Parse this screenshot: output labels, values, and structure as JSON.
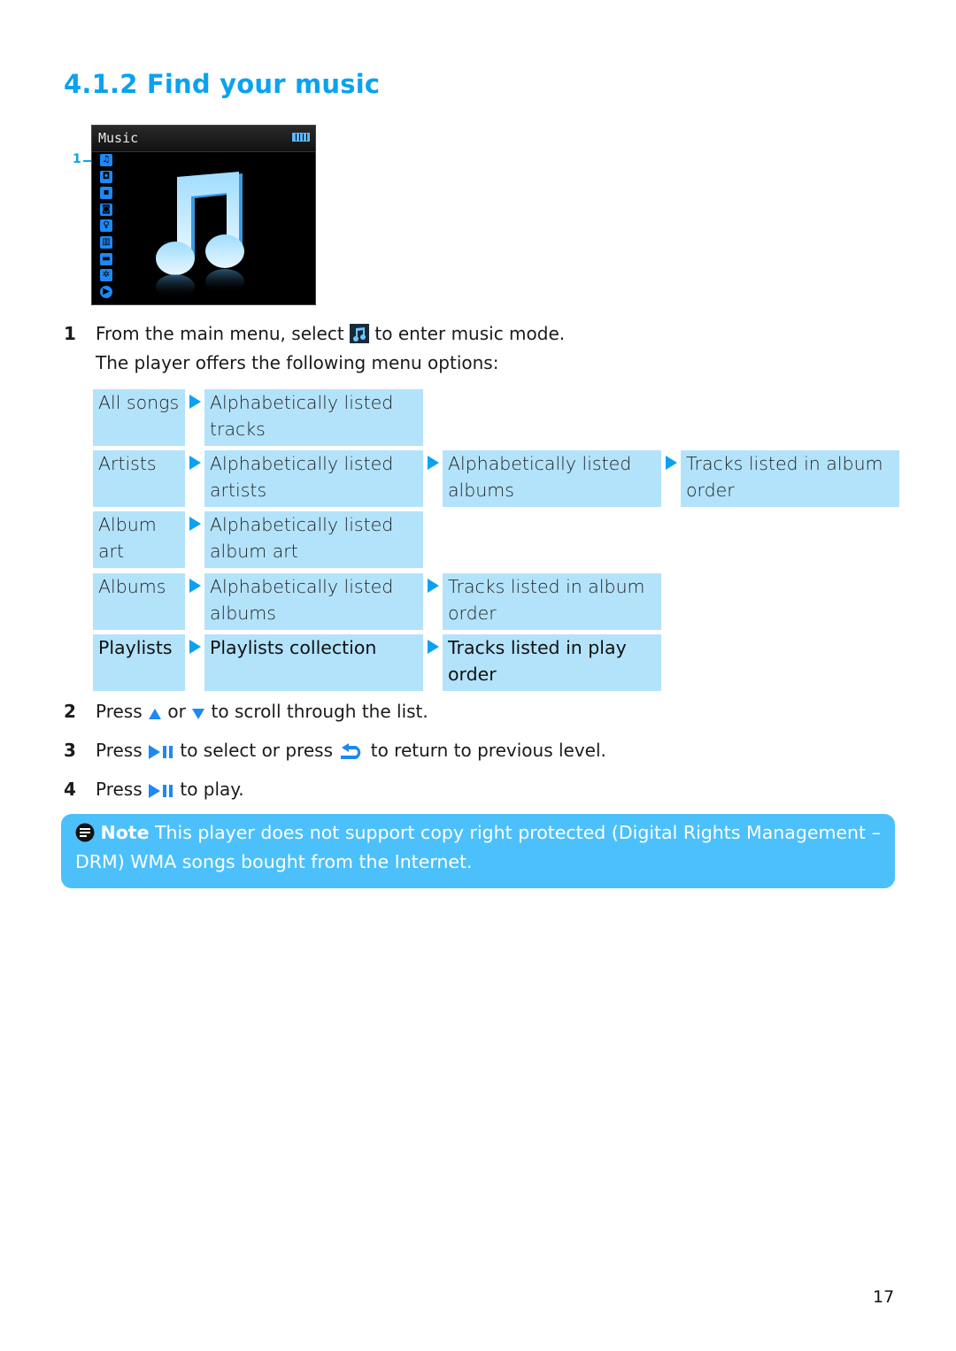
{
  "heading": "4.1.2 Find your music",
  "device_screen": {
    "title": "Music",
    "battery_icon": "battery-full-icon",
    "callout": "1",
    "menu_icons": [
      "music-note-icon",
      "camera-icon",
      "video-camera-icon",
      "radio-icon",
      "microphone-icon",
      "book-icon",
      "folder-icon",
      "gear-icon",
      "play-circle-icon"
    ],
    "hero_icon": "music-note-icon"
  },
  "steps": [
    {
      "num": "1",
      "parts": [
        "From the main menu, select ",
        "music-icon",
        " to enter music mode."
      ],
      "line2": "The player offers the following menu options:"
    },
    {
      "num": "2",
      "text_a": "Press ",
      "icon_a": "up-triangle-icon",
      "text_b": " or ",
      "icon_b": "down-triangle-icon",
      "text_c": " to scroll through the list."
    },
    {
      "num": "3",
      "text_a": "Press ",
      "icon_a": "play-pause-icon",
      "text_b": " to select or press ",
      "icon_b": "back-arrow-icon",
      "text_c": " to return to previous level."
    },
    {
      "num": "4",
      "text_a": "Press ",
      "icon_a": "play-pause-icon",
      "text_b": " to play."
    }
  ],
  "menu_table": {
    "rows": [
      {
        "label": "All songs",
        "levels": [
          "Alphabetically listed tracks"
        ]
      },
      {
        "label": "Artists",
        "levels": [
          "Alphabetically listed artists",
          "Alphabetically listed albums",
          "Tracks listed in album order"
        ]
      },
      {
        "label": "Album art",
        "levels": [
          "Alphabetically listed album art"
        ]
      },
      {
        "label": "Albums",
        "levels": [
          "Alphabetically listed albums",
          "Tracks listed in album order"
        ]
      },
      {
        "label": "Playlists",
        "levels": [
          "Playlists collection",
          "Tracks listed in play order"
        ],
        "bold": true
      }
    ]
  },
  "note": {
    "icon": "note-icon",
    "label": "Note",
    "text": " This player does not support copy right protected (Digital Rights Management – DRM) WMA songs bought from the Internet."
  },
  "page_number": "17",
  "colors": {
    "accent": "#0aa2f0",
    "cell_bg": "#b3e3fb",
    "note_bg": "#4cc0fb"
  }
}
